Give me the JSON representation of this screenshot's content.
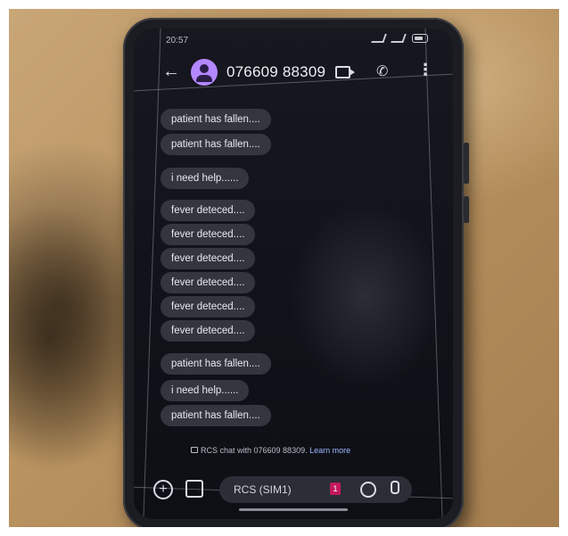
{
  "status_bar": {
    "time": "20:57"
  },
  "header": {
    "contact": "076609 88309"
  },
  "messages": [
    {
      "text": "patient has fallen...."
    },
    {
      "text": "patient has fallen...."
    },
    {
      "text": "i need help......"
    },
    {
      "text": "fever deteced...."
    },
    {
      "text": "fever deteced...."
    },
    {
      "text": "fever deteced...."
    },
    {
      "text": "fever deteced...."
    },
    {
      "text": "fever deteced...."
    },
    {
      "text": "fever deteced...."
    },
    {
      "text": "patient has fallen...."
    },
    {
      "text": "i need help......"
    },
    {
      "text": "patient has fallen...."
    }
  ],
  "rcs_notice": {
    "text": "RCS chat with 076609 88309.",
    "link": "Learn more"
  },
  "composer": {
    "placeholder": "RCS (SIM1)",
    "sim_badge": "1"
  },
  "colors": {
    "avatar": "#b388ff",
    "bubble": "#34363f",
    "link": "#9db8ff",
    "sim": "#c2185b"
  }
}
